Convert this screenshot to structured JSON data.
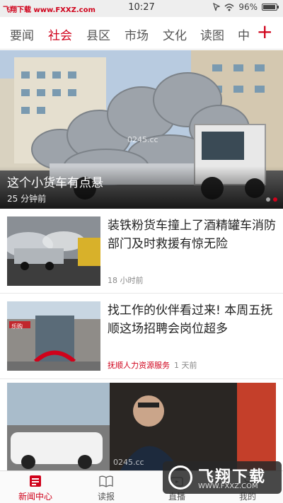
{
  "status_bar": {
    "watermark": "飞翔下载 www.FXXZ.com",
    "time": "10:27",
    "battery": "96%"
  },
  "tabs": [
    {
      "label": "要闻",
      "active": false
    },
    {
      "label": "社会",
      "active": true
    },
    {
      "label": "县区",
      "active": false
    },
    {
      "label": "市场",
      "active": false
    },
    {
      "label": "文化",
      "active": false
    },
    {
      "label": "读图",
      "active": false
    },
    {
      "label": "中",
      "active": false
    }
  ],
  "add_button": "+",
  "hero": {
    "title": "这个小货车有点悬",
    "time": "25 分钟前",
    "image_watermark": "0245.cc",
    "slide_count": 2,
    "active_slide": 1
  },
  "articles": [
    {
      "title": "装铁粉货车撞上了酒精罐车消防部门及时救援有惊无险",
      "source": "",
      "time": "18 小时前"
    },
    {
      "title": "找工作的伙伴看过来! 本周五抚顺这场招聘会岗位超多",
      "source": "抚顺人力资源服务",
      "time": "1 天前",
      "image_sign": "乐购"
    },
    {
      "title": "",
      "source": "",
      "time": "",
      "image_watermark": "0245.cc"
    }
  ],
  "bottom_nav": [
    {
      "label": "新闻中心",
      "icon": "newspaper-icon",
      "active": true
    },
    {
      "label": "读报",
      "icon": "open-book-icon",
      "active": false
    },
    {
      "label": "直播",
      "icon": "live-icon",
      "active": false
    },
    {
      "label": "我的",
      "icon": "profile-icon",
      "active": false
    }
  ],
  "overlay_watermark": {
    "title": "飞翔下载",
    "url": "WWW.FXXZ.COM"
  },
  "colors": {
    "accent": "#d0021b",
    "tab_inactive": "#555555",
    "meta": "#888888"
  }
}
